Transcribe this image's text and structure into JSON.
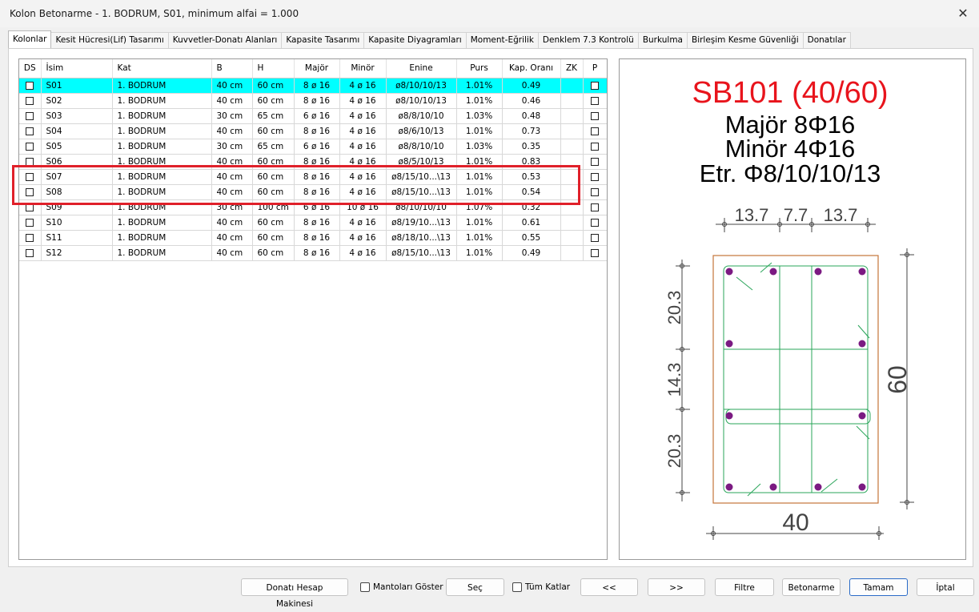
{
  "window": {
    "title": "Kolon Betonarme - 1. BODRUM, S01, minimum alfai = 1.000",
    "close_glyph": "✕"
  },
  "tabs": [
    "Kolonlar",
    "Kesit Hücresi(Lif) Tasarımı",
    "Kuvvetler-Donatı Alanları",
    "Kapasite Tasarımı",
    "Kapasite Diyagramları",
    "Moment-Eğrilik",
    "Denklem 7.3 Kontrolü",
    "Burkulma",
    "Birleşim Kesme Güvenliği",
    "Donatılar"
  ],
  "active_tab": 0,
  "table": {
    "columns": [
      "DS",
      "İsim",
      "Kat",
      "B",
      "H",
      "Majör",
      "Minör",
      "Enine",
      "Purs",
      "Kap. Oranı",
      "ZK",
      "P"
    ],
    "rows": [
      {
        "name": "S01",
        "kat": "1. BODRUM",
        "b": "40 cm",
        "h": "60 cm",
        "major": "8 ø 16",
        "minor": "4 ø 16",
        "enine": "ø8/10/10/13",
        "purs": "1.01%",
        "kap": "0.49"
      },
      {
        "name": "S02",
        "kat": "1. BODRUM",
        "b": "40 cm",
        "h": "60 cm",
        "major": "8 ø 16",
        "minor": "4 ø 16",
        "enine": "ø8/10/10/13",
        "purs": "1.01%",
        "kap": "0.46"
      },
      {
        "name": "S03",
        "kat": "1. BODRUM",
        "b": "30 cm",
        "h": "65 cm",
        "major": "6 ø 16",
        "minor": "4 ø 16",
        "enine": "ø8/8/10/10",
        "purs": "1.03%",
        "kap": "0.48"
      },
      {
        "name": "S04",
        "kat": "1. BODRUM",
        "b": "40 cm",
        "h": "60 cm",
        "major": "8 ø 16",
        "minor": "4 ø 16",
        "enine": "ø8/6/10/13",
        "purs": "1.01%",
        "kap": "0.73"
      },
      {
        "name": "S05",
        "kat": "1. BODRUM",
        "b": "30 cm",
        "h": "65 cm",
        "major": "6 ø 16",
        "minor": "4 ø 16",
        "enine": "ø8/8/10/10",
        "purs": "1.03%",
        "kap": "0.35"
      },
      {
        "name": "S06",
        "kat": "1. BODRUM",
        "b": "40 cm",
        "h": "60 cm",
        "major": "8 ø 16",
        "minor": "4 ø 16",
        "enine": "ø8/5/10/13",
        "purs": "1.01%",
        "kap": "0.83"
      },
      {
        "name": "S07",
        "kat": "1. BODRUM",
        "b": "40 cm",
        "h": "60 cm",
        "major": "8 ø 16",
        "minor": "4 ø 16",
        "enine": "ø8/15/10...\\13",
        "purs": "1.01%",
        "kap": "0.53"
      },
      {
        "name": "S08",
        "kat": "1. BODRUM",
        "b": "40 cm",
        "h": "60 cm",
        "major": "8 ø 16",
        "minor": "4 ø 16",
        "enine": "ø8/15/10...\\13",
        "purs": "1.01%",
        "kap": "0.54"
      },
      {
        "name": "S09",
        "kat": "1. BODRUM",
        "b": "30 cm",
        "h": "100 cm",
        "major": "6 ø 16",
        "minor": "10 ø 16",
        "enine": "ø8/10/10/10",
        "purs": "1.07%",
        "kap": "0.32"
      },
      {
        "name": "S10",
        "kat": "1. BODRUM",
        "b": "40 cm",
        "h": "60 cm",
        "major": "8 ø 16",
        "minor": "4 ø 16",
        "enine": "ø8/19/10...\\13",
        "purs": "1.01%",
        "kap": "0.61"
      },
      {
        "name": "S11",
        "kat": "1. BODRUM",
        "b": "40 cm",
        "h": "60 cm",
        "major": "8 ø 16",
        "minor": "4 ø 16",
        "enine": "ø8/18/10...\\13",
        "purs": "1.01%",
        "kap": "0.55"
      },
      {
        "name": "S12",
        "kat": "1. BODRUM",
        "b": "40 cm",
        "h": "60 cm",
        "major": "8 ø 16",
        "minor": "4 ø 16",
        "enine": "ø8/15/10...\\13",
        "purs": "1.01%",
        "kap": "0.49"
      }
    ],
    "selected_row": 0
  },
  "drawing": {
    "section_name": "SB101 (40/60)",
    "major_label": "Majör 8Φ16",
    "minor_label": "Minör 4Φ16",
    "stirrup_label": "Etr. Φ8/10/10/13",
    "dim_top": [
      "13.7",
      "7.7",
      "13.7"
    ],
    "dim_left": [
      "20.3",
      "14.3",
      "20.3"
    ],
    "dim_right": "60",
    "dim_bottom": "40",
    "colors": {
      "title": "#e8141c",
      "concrete": "#c4753a",
      "stirrup": "#2aa55a",
      "bar": "#7b1a82",
      "dim": "#444444"
    }
  },
  "buttons": {
    "calc": "Donatı Hesap Makinesi",
    "mantolar": "Mantoları Göster",
    "sec": "Seç",
    "tum_katlar": "Tüm Katlar",
    "prev": "<<",
    "next": ">>",
    "filtre": "Filtre",
    "betonarme": "Betonarme",
    "tamam": "Tamam",
    "iptal": "İptal"
  }
}
